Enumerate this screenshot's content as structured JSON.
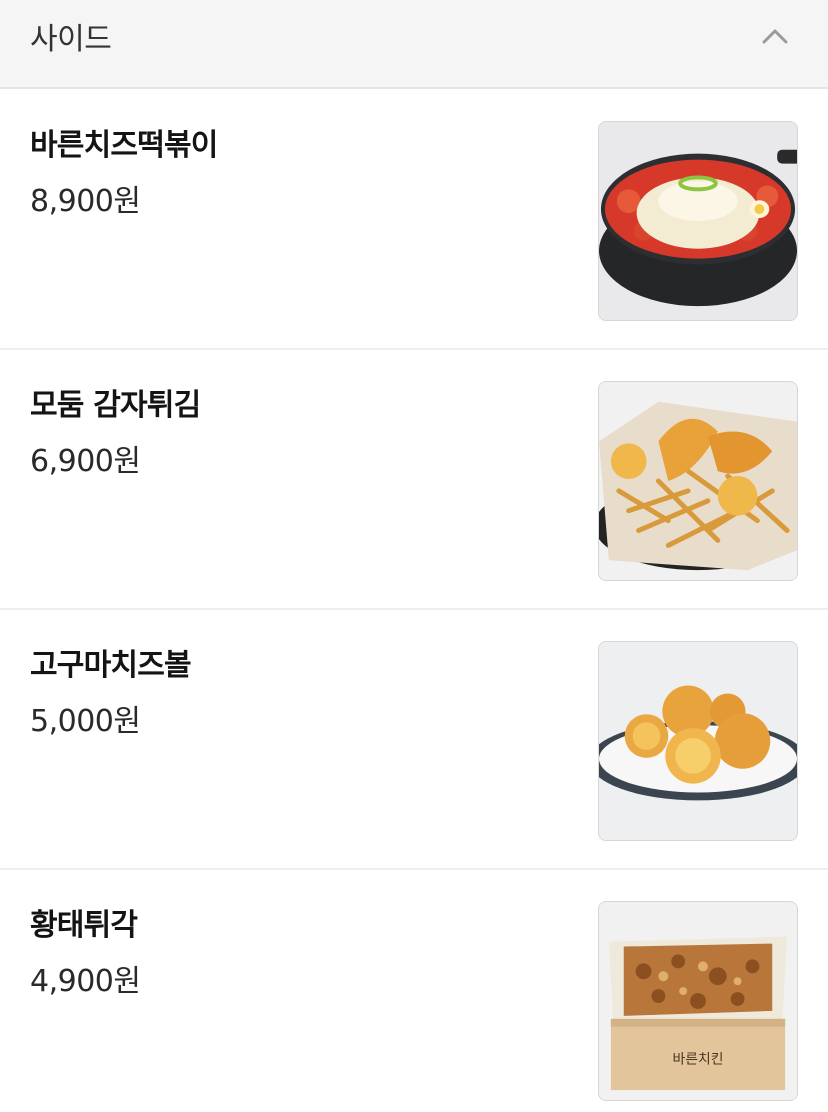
{
  "section": {
    "title": "사이드",
    "toggle_icon": "chevron-up-icon"
  },
  "items": [
    {
      "name": "바른치즈떡볶이",
      "price": "8,900원",
      "image_icon": "cheese-tteokbokki-photo"
    },
    {
      "name": "모둠 감자튀김",
      "price": "6,900원",
      "image_icon": "assorted-fries-photo"
    },
    {
      "name": "고구마치즈볼",
      "price": "5,000원",
      "image_icon": "sweet-potato-cheese-ball-photo"
    },
    {
      "name": "황태튀각",
      "price": "4,900원",
      "image_icon": "pollack-chips-photo",
      "box_label": "바른치킨"
    }
  ]
}
